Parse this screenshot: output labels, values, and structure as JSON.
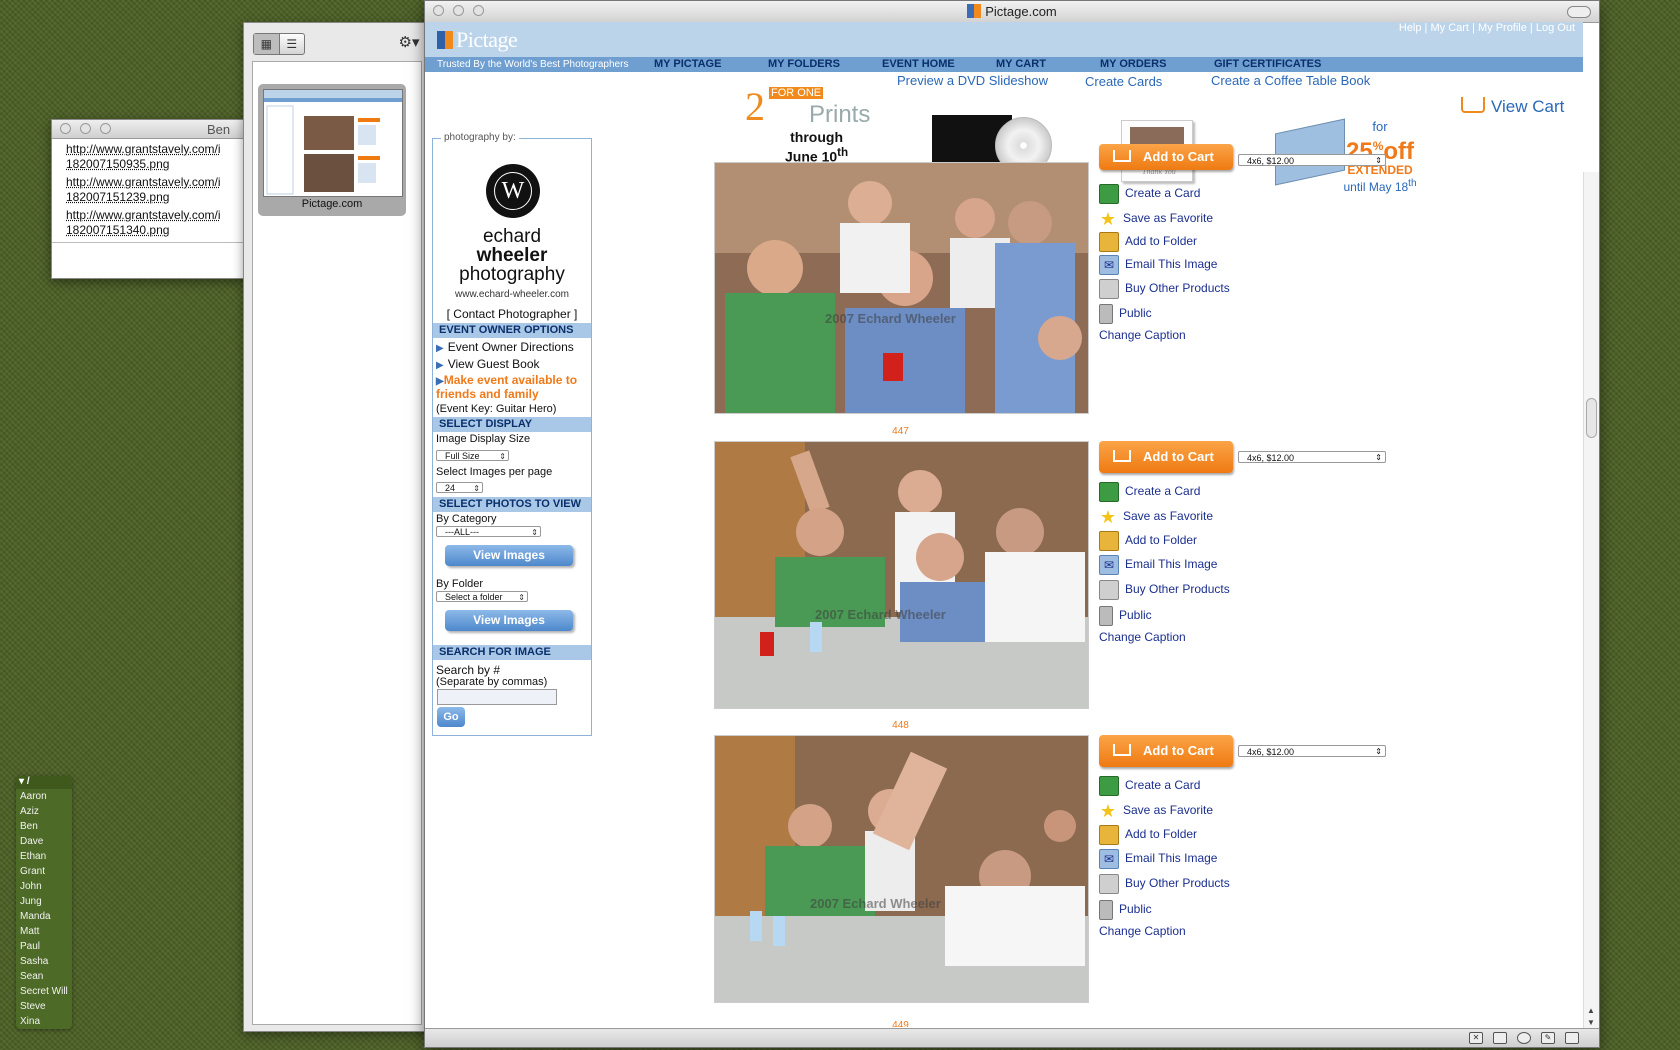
{
  "ben_window": {
    "title": "Ben",
    "links": [
      "http://www.grantstavely.com/i\n182007150935.png",
      "http://www.grantstavely.com/i\n182007151239.png",
      "http://www.grantstavely.com/i\n182007151340.png"
    ]
  },
  "thumbnail_panel": {
    "item_label": "Pictage.com"
  },
  "browser": {
    "title": "Pictage.com",
    "logo": "Pictage",
    "tagline": "Trusted By the World's Best Photographers",
    "utility_links": [
      "Help",
      "My Cart",
      "My Profile",
      "Log Out"
    ],
    "nav": [
      "MY PICTAGE",
      "MY FOLDERS",
      "EVENT HOME",
      "MY CART",
      "MY ORDERS",
      "GIFT CERTIFICATES"
    ],
    "promos": {
      "prints_big": "2",
      "prints_for_one": "FOR ONE",
      "prints_word": "Prints",
      "prints_through": "through",
      "prints_date": "June 10",
      "prints_date_sup": "th",
      "dvd": "Preview a DVD Slideshow",
      "cards": "Create Cards",
      "book": "Create a Coffee Table Book",
      "book_for": "for",
      "book_pct": "25",
      "book_pct_sym": "%",
      "book_off": "off",
      "book_extended": "EXTENDED",
      "book_until": "until May 18",
      "book_until_sup": "th",
      "card_text": "Thank You",
      "view_cart": "View Cart"
    },
    "sidebar": {
      "legend": "photography by:",
      "photographer_line1": "echard",
      "photographer_line2": "wheeler",
      "photographer_line3": "photography",
      "photographer_url": "www.echard-wheeler.com",
      "contact": "[ Contact Photographer ]",
      "owner_head": "EVENT OWNER OPTIONS",
      "owner_directions": "Event Owner Directions",
      "guest_book": "View Guest Book",
      "make_available": "Make event available to friends and family",
      "event_key": "(Event Key: Guitar Hero)",
      "display_head": "SELECT DISPLAY",
      "display_size_label": "Image Display Size",
      "display_size_value": "Full Size",
      "per_page_label": "Select Images per page",
      "per_page_value": "24",
      "photos_head": "SELECT PHOTOS TO VIEW",
      "category_label": "By Category",
      "category_value": "---ALL---",
      "view_images_1": "View Images",
      "folder_label": "By Folder",
      "folder_value": "Select a folder",
      "view_images_2": "View Images",
      "search_head": "SEARCH FOR IMAGE",
      "search_label": "Search by #",
      "search_hint": "(Separate by commas)",
      "go": "Go"
    },
    "photos": [
      {
        "number": "",
        "watermark": "2007 Echard Wheeler",
        "size_value": "4x6, $12.00"
      },
      {
        "number": "447",
        "watermark": "2007 Echard Wheeler",
        "size_value": "4x6, $12.00"
      },
      {
        "number": "448",
        "watermark": "2007 Echard Wheeler",
        "size_value": "4x6, $12.00"
      }
    ],
    "next_number": "449",
    "actions": {
      "add_to_cart": "Add to Cart",
      "create_card": "Create a Card",
      "save_favorite": "Save as Favorite",
      "add_folder": "Add to Folder",
      "email_image": "Email This Image",
      "buy_products": "Buy Other Products",
      "public": "Public",
      "change_caption": "Change Caption"
    }
  },
  "names_panel": {
    "header": "/",
    "names": [
      "Aaron",
      "Aziz",
      "Ben",
      "Dave",
      "Ethan",
      "Grant",
      "John",
      "Jung",
      "Manda",
      "Matt",
      "Paul",
      "Sasha",
      "Sean",
      "Secret Will",
      "Steve",
      "Xina"
    ]
  }
}
